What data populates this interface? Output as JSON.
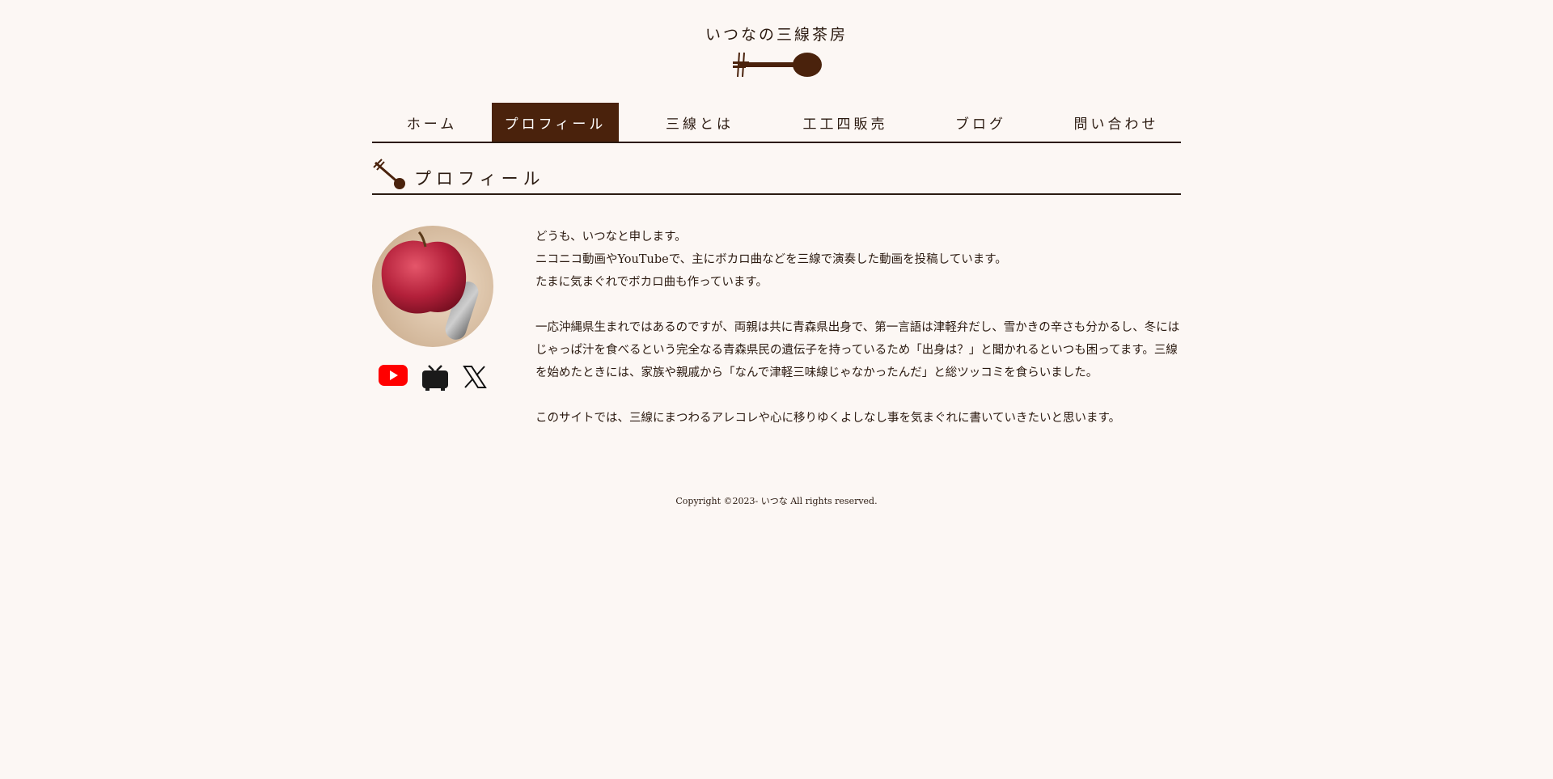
{
  "site": {
    "title": "いつなの三線茶房"
  },
  "nav": {
    "items": [
      {
        "label": "ホーム"
      },
      {
        "label": "プロフィール"
      },
      {
        "label": "三線とは"
      },
      {
        "label": "工工四販売"
      },
      {
        "label": "ブログ"
      },
      {
        "label": "問い合わせ"
      }
    ],
    "active_index": 1
  },
  "page": {
    "heading": "プロフィール"
  },
  "profile": {
    "social_icons": [
      "youtube-icon",
      "niconico-icon",
      "x-icon"
    ],
    "paragraphs": [
      [
        "どうも、いつなと申します。",
        "ニコニコ動画やYouTubeで、主にボカロ曲などを三線で演奏した動画を投稿しています。",
        "たまに気まぐれでボカロ曲も作っています。"
      ],
      [
        "一応沖縄県生まれではあるのですが、両親は共に青森県出身で、第一言語は津軽弁だし、雪かきの辛さも分かるし、冬にはじゃっぱ汁を食べるという完全なる青森県民の遺伝子を持っているため「出身は？」と聞かれるといつも困ってます。三線を始めたときには、家族や親戚から「なんで津軽三味線じゃなかったんだ」と総ツッコミを食らいました。"
      ],
      [
        "このサイトでは、三線にまつわるアレコレや心に移りゆくよしなし事を気まぐれに書いていきたいと思います。"
      ]
    ]
  },
  "footer": {
    "copyright": "Copyright ©2023- いつな All rights reserved."
  },
  "colors": {
    "accent": "#4a220c",
    "background": "#fcf7f4",
    "text": "#2b1a10"
  }
}
